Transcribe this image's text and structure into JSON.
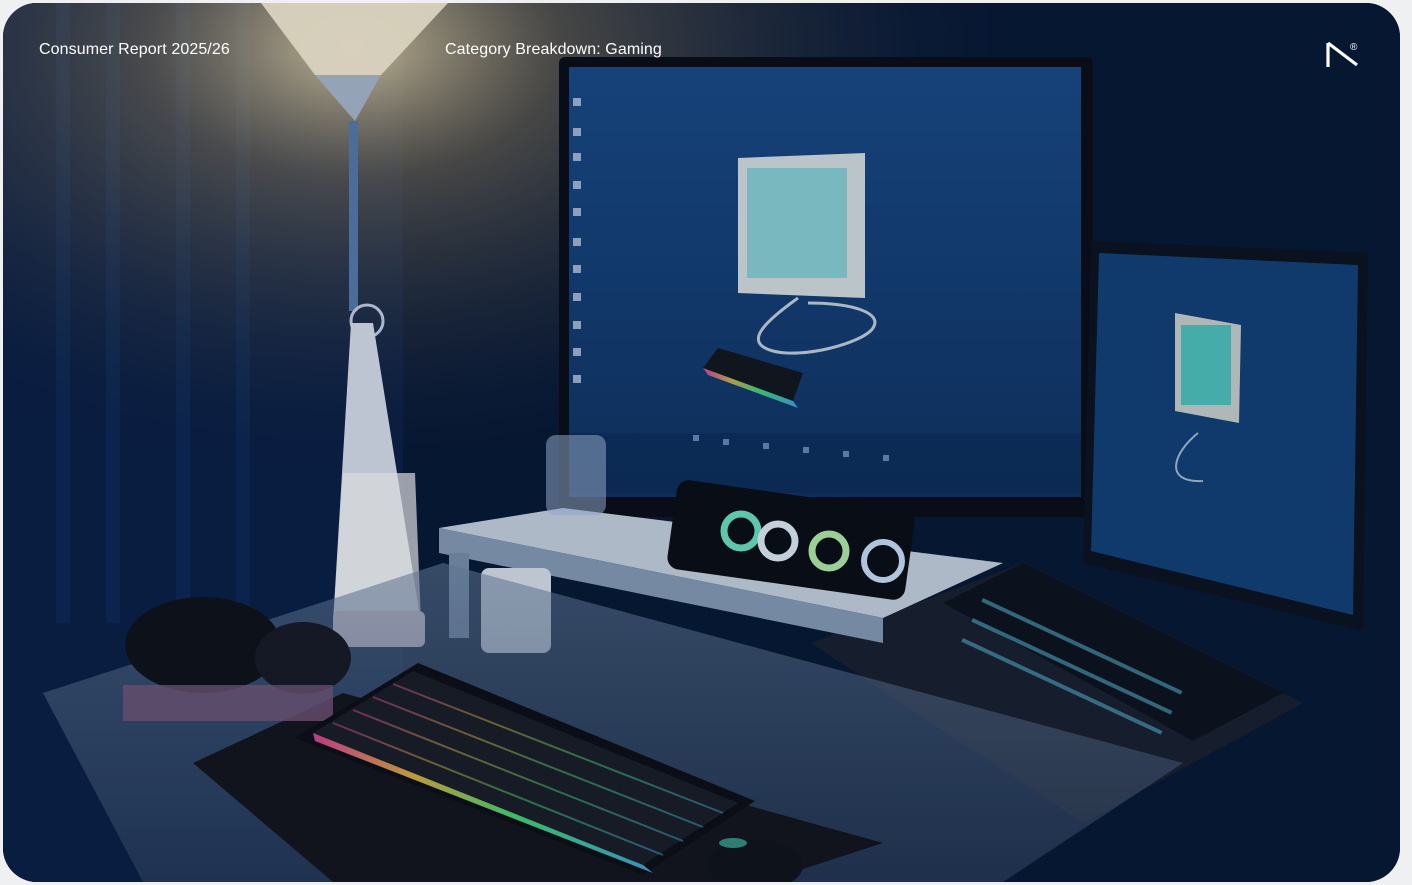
{
  "header": {
    "report_title": "Consumer Report 2025/26",
    "category_label": "Category Breakdown: Gaming"
  },
  "logo": {
    "icon": "brand-logo-icon",
    "mark": "®"
  },
  "photo": {
    "icon": "gaming-setup-photo"
  },
  "colors": {
    "text": "#ffffff",
    "accent_blue": "#0f3a78",
    "lamp_glow": "#f4e3b0",
    "page_bg": "#eef0f2"
  }
}
